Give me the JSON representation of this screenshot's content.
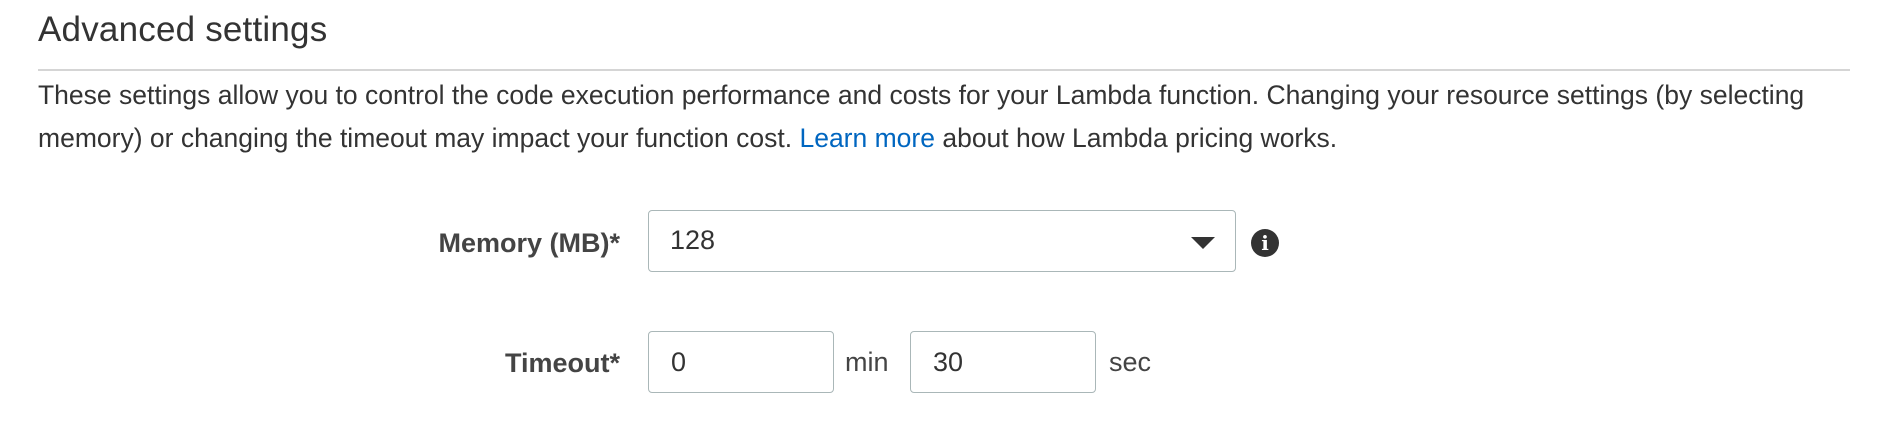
{
  "section": {
    "title": "Advanced settings",
    "description_before_link": "These settings allow you to control the code execution performance and costs for your Lambda function. Changing your resource settings (by selecting memory) or changing the timeout may impact your function cost. ",
    "learn_more_link": "Learn more",
    "description_after_link": " about how Lambda pricing works."
  },
  "memory": {
    "label": "Memory (MB)*",
    "selected_value": "128",
    "info_icon": "info-icon"
  },
  "timeout": {
    "label": "Timeout*",
    "minutes_value": "0",
    "minutes_unit": "min",
    "seconds_value": "30",
    "seconds_unit": "sec"
  },
  "colors": {
    "link": "#0066c0",
    "text": "#333333",
    "input_border": "#aab7b8",
    "divider": "#d5d5d5"
  }
}
